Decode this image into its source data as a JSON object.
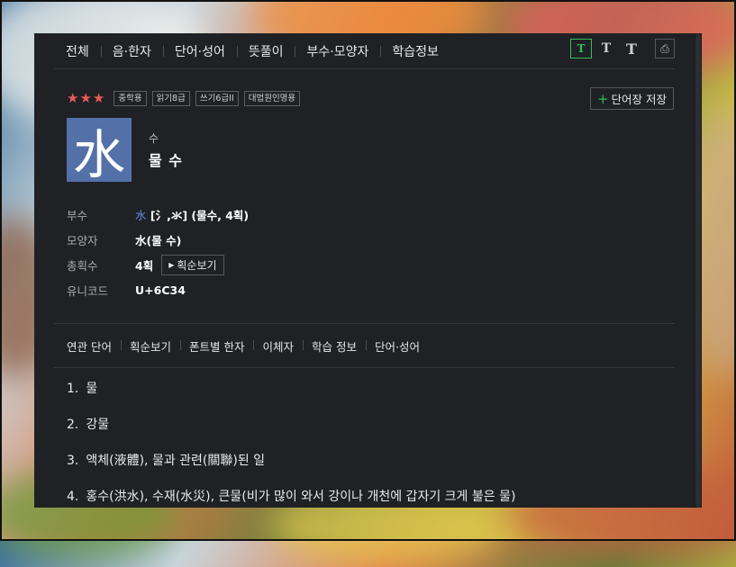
{
  "nav": {
    "items": [
      "전체",
      "음·한자",
      "단어·성어",
      "뜻풀이",
      "부수·모양자",
      "학습정보"
    ]
  },
  "font_controls": {
    "small": "T",
    "medium": "T",
    "large": "T",
    "print": "⎙",
    "accent": "#2fbf5b"
  },
  "badges": {
    "stars": "★★★",
    "items": [
      "중학용",
      "읽기8급",
      "쓰기6급II",
      "대법원인명용"
    ]
  },
  "save_button": {
    "plus": "+",
    "label": "단어장 저장"
  },
  "entry": {
    "hanja": "水",
    "reading_small": "수",
    "reading_main": "물 수",
    "box_color": "#5470a8"
  },
  "info": {
    "radical_label": "부수",
    "radical_char": "水",
    "radical_rest": " [氵,氺] (물수, 4획)",
    "shape_label": "모양자",
    "shape_value": "水(물 수)",
    "strokes_label": "총획수",
    "strokes_value": "4획",
    "stroke_button": "획순보기",
    "stroke_button_icon": "▶",
    "unicode_label": "유니코드",
    "unicode_value": "U+6C34"
  },
  "subtabs": [
    "연관 단어",
    "획순보기",
    "폰트별 한자",
    "이체자",
    "학습 정보",
    "단어·성어"
  ],
  "definitions": [
    {
      "num": "1.",
      "text": "물"
    },
    {
      "num": "2.",
      "text": "강물"
    },
    {
      "num": "3.",
      "text": "액체(液體), 물과 관련(關聯)된 일"
    },
    {
      "num": "4.",
      "text": "홍수(洪水), 수재(水災), 큰물(비가 많이 와서 강이나 개천에 갑자기 크게 불은 물)"
    }
  ]
}
